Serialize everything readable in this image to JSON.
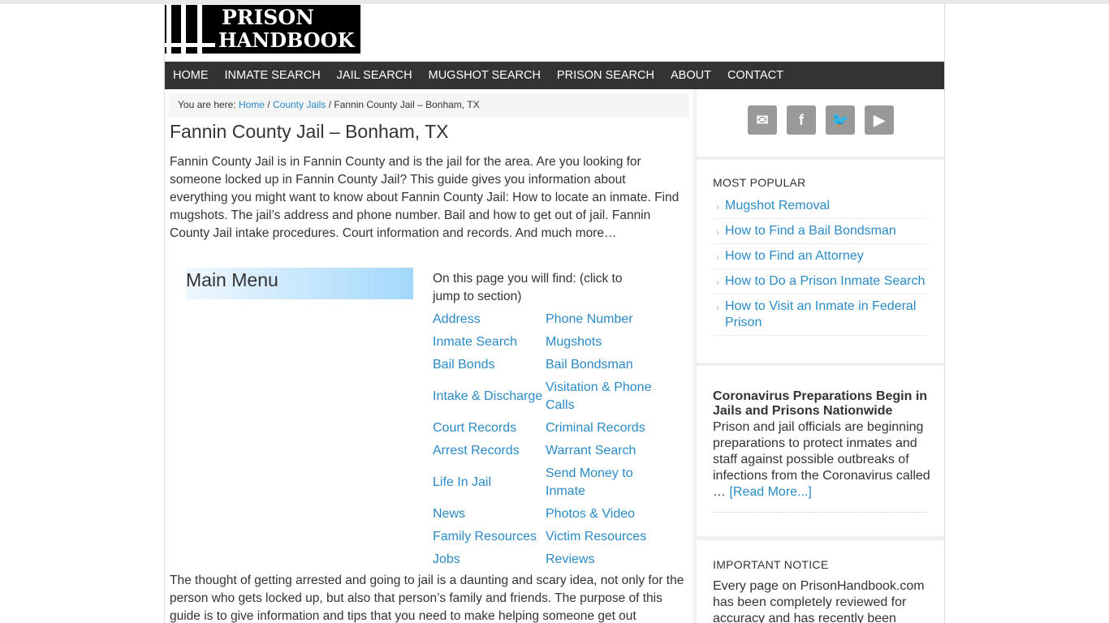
{
  "logo": {
    "line1": "PRISON",
    "line2": "HANDBOOK"
  },
  "nav": {
    "items": [
      {
        "label": "HOME"
      },
      {
        "label": "INMATE SEARCH"
      },
      {
        "label": "JAIL SEARCH"
      },
      {
        "label": "MUGSHOT SEARCH"
      },
      {
        "label": "PRISON SEARCH"
      },
      {
        "label": "ABOUT"
      },
      {
        "label": "CONTACT"
      }
    ]
  },
  "breadcrumb": {
    "prefix": "You are here: ",
    "home": "Home",
    "sep1": " / ",
    "section": "County Jails",
    "sep2": " / ",
    "current": "Fannin County Jail – Bonham, TX"
  },
  "page": {
    "title": "Fannin County Jail – Bonham, TX",
    "intro": "Fannin County Jail is in Fannin County and is the jail for the area. Are you looking for someone locked up in Fannin County Jail? This guide gives you information about everything you might want to know about Fannin County Jail: How to locate an inmate. Find mugshots. The jail’s address and phone number. Bail and how to get out of jail. Fannin County Jail intake procedures. Court information and records. And much more…",
    "main_menu_label": "Main Menu",
    "toc_intro": "On this page you will find: (click to jump to section)",
    "toc": [
      "Address",
      "Phone Number",
      "Inmate Search",
      "Mugshots",
      "Bail Bonds",
      "Bail Bondsman",
      "Intake & Discharge",
      "Visitation & Phone Calls",
      "Court Records",
      "Criminal Records",
      "Arrest Records",
      "Warrant Search",
      "Life In Jail",
      "Send Money to Inmate",
      "News",
      "Photos & Video",
      "Family Resources",
      "Victim Resources",
      "Jobs",
      "Reviews"
    ],
    "after": "The thought of getting arrested and going to jail is a daunting and scary idea, not only for the person who gets locked up, but also that person’s family and friends. The purpose of this guide is to give information and tips that you need to make helping someone get out"
  },
  "sidebar": {
    "social": [
      {
        "icon": "email-icon",
        "glyph": "✉"
      },
      {
        "icon": "facebook-icon",
        "glyph": "f"
      },
      {
        "icon": "twitter-icon",
        "glyph": "🐦"
      },
      {
        "icon": "youtube-icon",
        "glyph": "▶"
      }
    ],
    "popular_title": "MOST POPULAR",
    "popular": [
      "Mugshot Removal",
      "How to Find a Bail Bondsman",
      "How to Find an Attorney",
      "How to Do a Prison Inmate Search",
      "How to Visit an Inmate in Federal Prison"
    ],
    "news": {
      "title": "Coronavirus Preparations Begin in Jails and Prisons Nationwide",
      "body": "Prison and jail officials are beginning preparations to protect inmates and staff against possible outbreaks of infections from the Coronavirus called … ",
      "read_more": "[Read More...]"
    },
    "notice_title": "IMPORTANT NOTICE",
    "notice_body": "Every page on PrisonHandbook.com has been completely reviewed for accuracy and has recently been"
  },
  "colors": {
    "link": "#2a8ac6",
    "nav_bg": "#333333",
    "social_bg": "#999999"
  }
}
